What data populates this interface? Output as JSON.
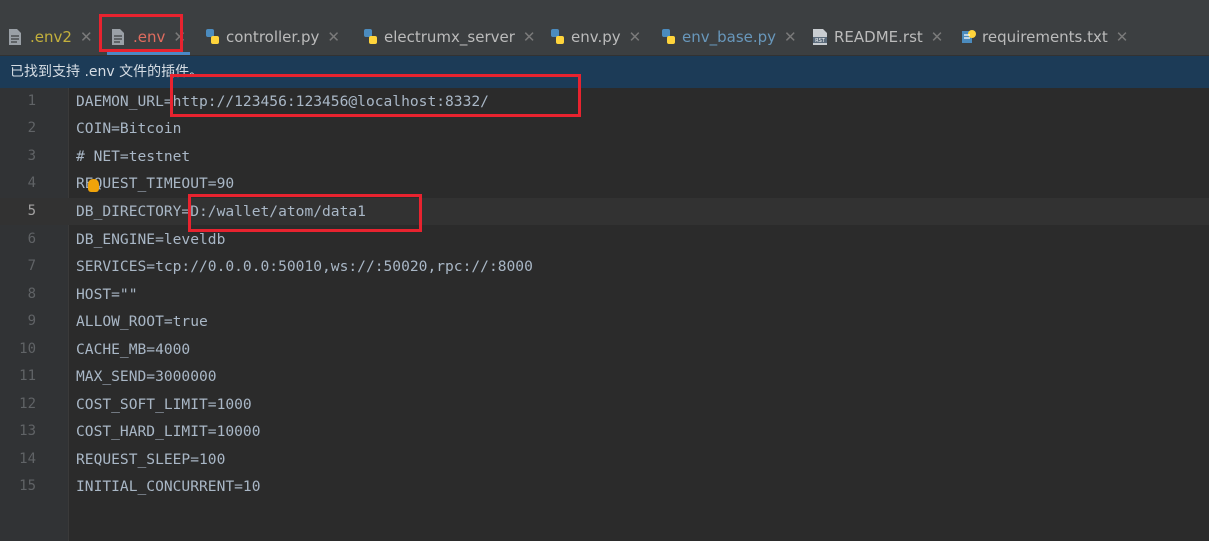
{
  "tabs": [
    {
      "label": ".env2",
      "icon": "file-icon",
      "color": "#c3b03c"
    },
    {
      "label": ".env",
      "icon": "file-icon",
      "active": true
    },
    {
      "label": "controller.py",
      "icon": "python-icon"
    },
    {
      "label": "electrumx_server",
      "icon": "python-icon"
    },
    {
      "label": "env.py",
      "icon": "python-icon"
    },
    {
      "label": "env_base.py",
      "icon": "python-icon",
      "color": "#6897bb"
    },
    {
      "label": "README.rst",
      "icon": "rst-file-icon"
    },
    {
      "label": "requirements.txt",
      "icon": "requirements-icon"
    }
  ],
  "notification": "已找到支持 .env 文件的插件。",
  "lines": [
    {
      "num": "1",
      "text": "DAEMON_URL=http://123456:123456@localhost:8332/"
    },
    {
      "num": "2",
      "text": "COIN=Bitcoin"
    },
    {
      "num": "3",
      "text": "# NET=testnet"
    },
    {
      "num": "4",
      "text": "REQUEST_TIMEOUT=90"
    },
    {
      "num": "5",
      "text": "DB_DIRECTORY=D:/wallet/atom/data1"
    },
    {
      "num": "6",
      "text": "DB_ENGINE=leveldb"
    },
    {
      "num": "7",
      "text": "SERVICES=tcp://0.0.0.0:50010,ws://:50020,rpc://:8000"
    },
    {
      "num": "8",
      "text": "HOST=\"\""
    },
    {
      "num": "9",
      "text": "ALLOW_ROOT=true"
    },
    {
      "num": "10",
      "text": "CACHE_MB=4000"
    },
    {
      "num": "11",
      "text": "MAX_SEND=3000000"
    },
    {
      "num": "12",
      "text": "COST_SOFT_LIMIT=1000"
    },
    {
      "num": "13",
      "text": "COST_HARD_LIMIT=10000"
    },
    {
      "num": "14",
      "text": "REQUEST_SLEEP=100"
    },
    {
      "num": "15",
      "text": "INITIAL_CONCURRENT=10"
    }
  ],
  "current_line": "5",
  "colors": {
    "highlight_box": "#e8232f",
    "tab_active_underline": "#4a88c7",
    "notification_bg": "#1c3b57"
  }
}
